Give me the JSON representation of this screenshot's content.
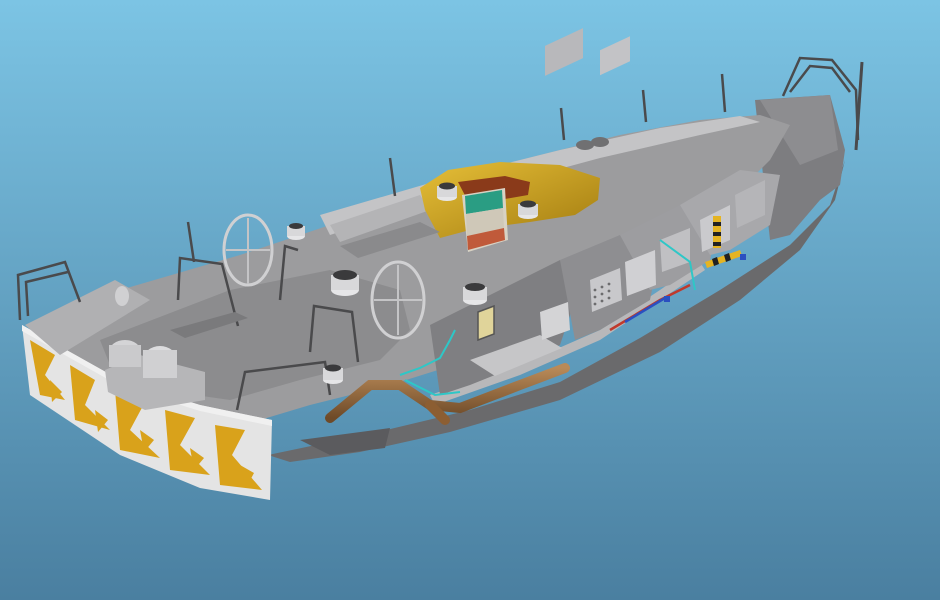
{
  "viewport": {
    "background_top": "#7cc4e4",
    "background_bottom": "#4a7fa0"
  },
  "model": {
    "hull_color": "#8a8a8c",
    "deck_color": "#9c9c9e",
    "deck_light": "#c4c4c6",
    "structure_dark": "#5e5e60",
    "stern_panel_color": "#e4e4e4",
    "stern_pattern_color": "#d9a21b",
    "canopy_color": "#d7ab1e",
    "pipe_color": "#9a6b3e",
    "cable_color": "#2ec7c7",
    "cable_red": "#c0392b",
    "cable_blue": "#2b4fc0"
  }
}
